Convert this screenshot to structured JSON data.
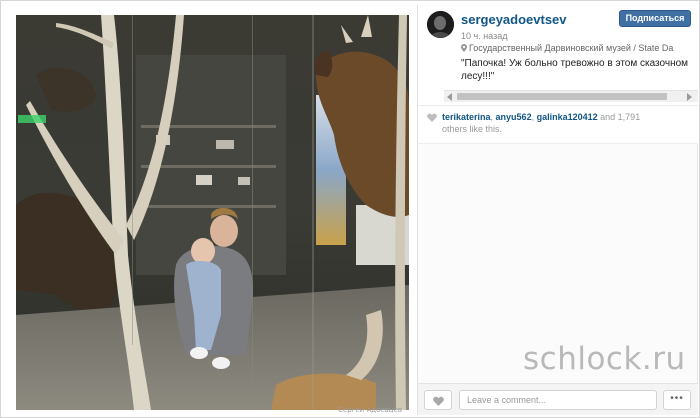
{
  "post": {
    "username": "sergeyadoevtsev",
    "follow_label": "Подписаться",
    "time_ago": "10 ч. назад",
    "location": "Государственный Дарвиновский музей / State Da",
    "caption": "\"Папочка! Уж больно тревожно в этом сказочном лесу!!!\""
  },
  "photo": {
    "credit": "Сергей Адоевцев",
    "description_icon": "photo-museum-diorama"
  },
  "likes": {
    "users": [
      "terikaterina",
      "anyu562",
      "galinka120412"
    ],
    "sep1": ", ",
    "sep2": ", ",
    "and_text": " and ",
    "count": "1,791",
    "suffix": "others like this."
  },
  "footer": {
    "comment_placeholder": "Leave a comment...",
    "more_label": "•••"
  },
  "watermark": "schlock.ru",
  "colors": {
    "link": "#125688",
    "follow_button": "#3f6fa3"
  }
}
